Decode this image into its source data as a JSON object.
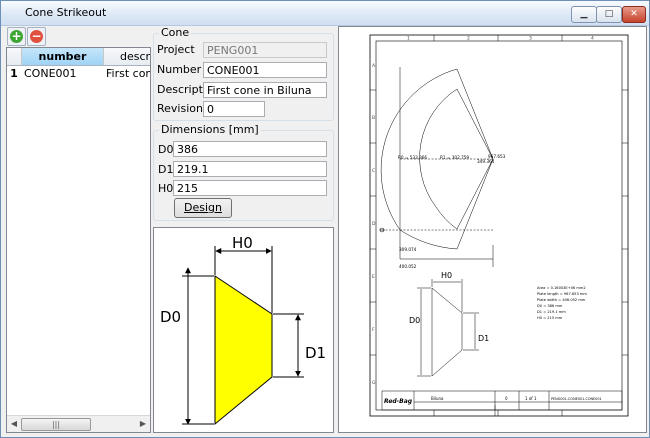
{
  "window": {
    "title": "Cone Strikeout",
    "minimize_glyph": "▁",
    "maximize_glyph": "□",
    "close_glyph": "✕"
  },
  "toolbar": {
    "add_icon": "plus-circle-icon",
    "add_glyph": "+",
    "remove_icon": "minus-circle-icon",
    "remove_glyph": "−"
  },
  "grid": {
    "columns": [
      "number",
      "descrip"
    ],
    "rows": [
      {
        "index": "1",
        "number": "CONE001",
        "description": "First cone"
      }
    ],
    "scroll_thumb": "|||"
  },
  "cone": {
    "legend": "Cone",
    "project_label": "Project",
    "project_value": "PENG001",
    "number_label": "Number",
    "number_value": "CONE001",
    "description_label": "Description",
    "description_value": "First cone in Biluna",
    "revision_label": "Revision",
    "revision_value": "0"
  },
  "dimensions": {
    "legend": "Dimensions [mm]",
    "d0_label": "D0",
    "d0_value": "386",
    "d1_label": "D1",
    "d1_value": "219.1",
    "h0_label": "H0",
    "h0_value": "215",
    "design_button": "Design"
  },
  "diagram": {
    "h0": "H0",
    "d0": "D0",
    "d1": "D1",
    "fill_color": "#ffff00"
  },
  "preview": {
    "col_numbers": [
      "1",
      "2",
      "3",
      "4"
    ],
    "row_letters": [
      "A",
      "B",
      "C",
      "D",
      "E",
      "F",
      "G"
    ],
    "r0_label": "R0 = 533.366",
    "r1_label": "R1 = 302.759",
    "angle_label": "967.653",
    "chord_inner": "349.364",
    "width_bottom": "309.074",
    "width_total": "400.052",
    "h0": "H0",
    "d0": "D0",
    "d1": "D1",
    "notes": [
      "Area = 0.16003E+06 mm2",
      "Plate length = 967.653 mm",
      "Plate width = 406.052 mm",
      "D0 = 386 mm",
      "D1 = 219.1 mm",
      "H0 = 215 mm"
    ],
    "logo": "Red-Bag",
    "company": "Biluna",
    "revision": "0",
    "sheet": "1 of 1",
    "drawing_number": "PENG001-CONE001-CONE001"
  }
}
